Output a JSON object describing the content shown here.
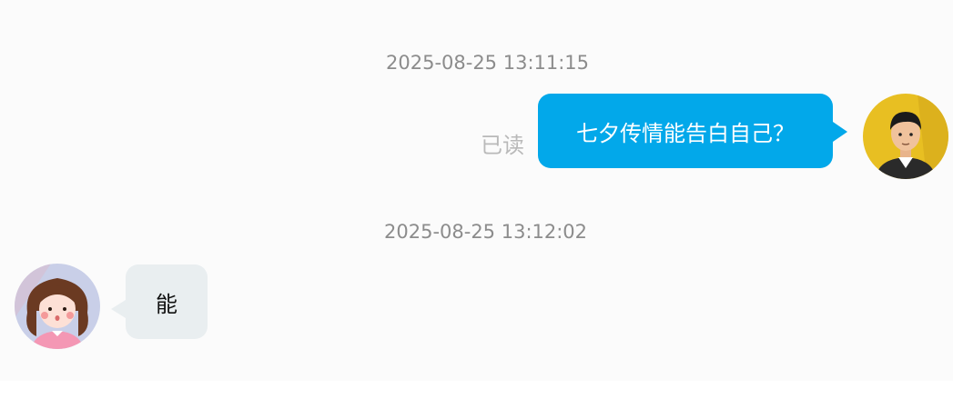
{
  "messages": [
    {
      "timestamp": "2025-08-25 13:11:15",
      "direction": "outgoing",
      "text": "七夕传情能告白自己？",
      "read_status": "已读",
      "bubble_color": "#02a8ea",
      "avatar": "male-user-avatar"
    },
    {
      "timestamp": "2025-08-25 13:12:02",
      "direction": "incoming",
      "text": "能",
      "bubble_color": "#e9eef0",
      "avatar": "female-contact-avatar"
    }
  ]
}
